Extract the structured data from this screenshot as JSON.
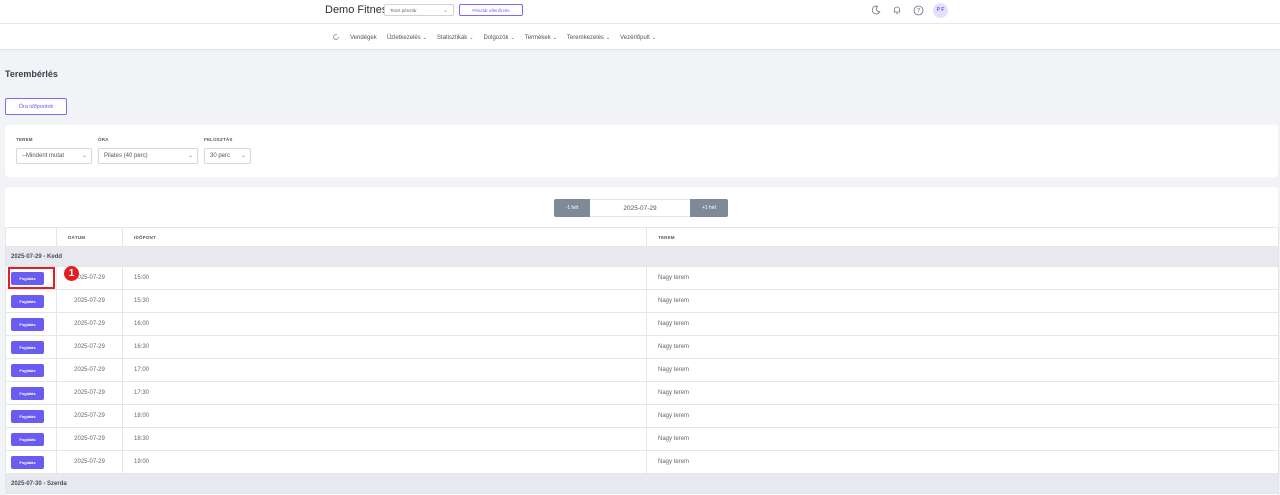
{
  "header": {
    "brand": "Demo Fitness",
    "register_select": "Teszt pénztár",
    "register_check": "Pénztár ellenőrzés",
    "avatar_initials": "P F",
    "icons": [
      "moon-icon",
      "bell-icon",
      "help-icon"
    ]
  },
  "nav": {
    "items": [
      {
        "label": "Vendégek"
      },
      {
        "label": "Üzletkezelés"
      },
      {
        "label": "Statisztikák"
      },
      {
        "label": "Dolgozók"
      },
      {
        "label": "Termékek"
      },
      {
        "label": "Teremkezelés"
      },
      {
        "label": "Vezérlőpult"
      }
    ]
  },
  "page": {
    "title": "Terembérlés",
    "times_button": "Óra időpontok"
  },
  "filters": {
    "room_label": "TEREM",
    "room_value": "--Mindent mutat",
    "class_label": "ÓRA",
    "class_value": "Pilates (40 perc)",
    "split_label": "FELOSZTÁS",
    "split_value": "30 perc"
  },
  "week_nav": {
    "prev": "-1 hét",
    "date": "2025-07-29",
    "next": "+1 hét"
  },
  "table": {
    "headers": [
      "",
      "DÁTUM",
      "IDŐPONT",
      "TEREM"
    ],
    "book_label": "Foglalás",
    "groups": [
      {
        "label": "2025-07-29 - Kedd",
        "rows": [
          {
            "date": "2025-07-29",
            "time": "15:00",
            "room": "Nagy terem"
          },
          {
            "date": "2025-07-29",
            "time": "15:30",
            "room": "Nagy terem"
          },
          {
            "date": "2025-07-29",
            "time": "16:00",
            "room": "Nagy terem"
          },
          {
            "date": "2025-07-29",
            "time": "16:30",
            "room": "Nagy terem"
          },
          {
            "date": "2025-07-29",
            "time": "17:00",
            "room": "Nagy terem"
          },
          {
            "date": "2025-07-29",
            "time": "17:30",
            "room": "Nagy terem"
          },
          {
            "date": "2025-07-29",
            "time": "18:00",
            "room": "Nagy terem"
          },
          {
            "date": "2025-07-29",
            "time": "18:30",
            "room": "Nagy terem"
          },
          {
            "date": "2025-07-29",
            "time": "19:00",
            "room": "Nagy terem"
          }
        ]
      },
      {
        "label": "2025-07-30 - Szerda",
        "rows": []
      }
    ]
  },
  "annotation": {
    "marker": "1"
  }
}
